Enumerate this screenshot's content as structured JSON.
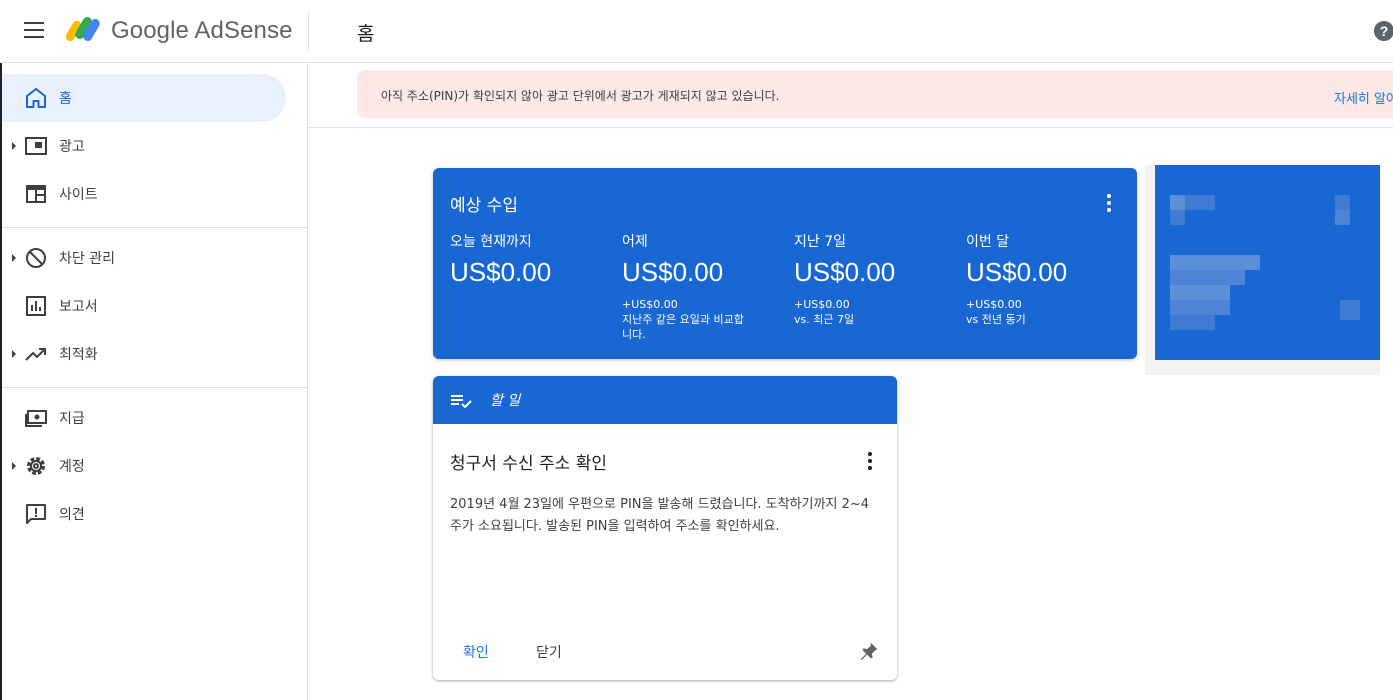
{
  "header": {
    "brand": "Google AdSense",
    "page_title": "홈",
    "help_glyph": "?"
  },
  "sidebar": {
    "items": [
      {
        "label": "홈",
        "icon": "home-icon",
        "active": true
      },
      {
        "label": "광고",
        "icon": "ads-icon",
        "caret": true
      },
      {
        "label": "사이트",
        "icon": "sites-icon"
      },
      {
        "label": "차단 관리",
        "icon": "block-icon",
        "caret": true
      },
      {
        "label": "보고서",
        "icon": "reports-icon"
      },
      {
        "label": "최적화",
        "icon": "trending-up-icon",
        "caret": true
      },
      {
        "label": "지급",
        "icon": "payments-icon"
      },
      {
        "label": "계정",
        "icon": "gear-icon",
        "caret": true
      },
      {
        "label": "의견",
        "icon": "feedback-icon"
      }
    ]
  },
  "alert": {
    "text": "아직 주소(PIN)가 확인되지 않아 광고 단위에서 광고가 게재되지 않고 있습니다.",
    "link": "자세히 알아보기"
  },
  "earnings": {
    "title": "예상 수입",
    "columns": [
      {
        "label": "오늘 현재까지",
        "value": "US$0.00",
        "delta": ""
      },
      {
        "label": "어제",
        "value": "US$0.00",
        "delta": "+US$0.00\n지난주 같은 요일과 비교합\n니다."
      },
      {
        "label": "지난 7일",
        "value": "US$0.00",
        "delta": "+US$0.00\nvs. 최근 7일"
      },
      {
        "label": "이번 달",
        "value": "US$0.00",
        "delta": "+US$0.00\nvs 전년 동기"
      }
    ]
  },
  "todo": {
    "header": "할 일",
    "task_title": "청구서 수신 주소 확인",
    "task_body": "2019년 4월 23일에 우편으로 PIN을 발송해 드렸습니다. 도착하기까지 2~4주가 소요됩니다. 발송된 PIN을 입력하여 주소를 확인하세요.",
    "confirm_label": "확인",
    "dismiss_label": "닫기"
  },
  "colors": {
    "primary": "#1967d2",
    "link": "#1a73e8",
    "alert_bg": "#fce8e6",
    "active_nav_bg": "#e8f0fe"
  }
}
